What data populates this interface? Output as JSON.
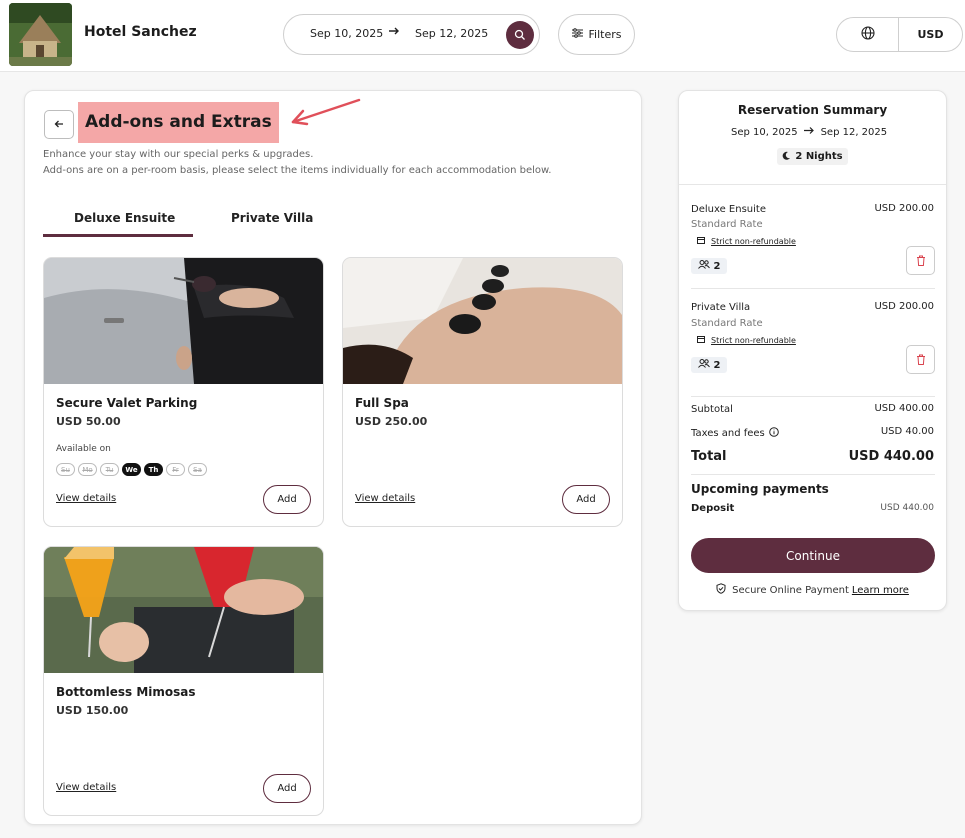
{
  "header": {
    "hotel_name": "Hotel Sanchez",
    "check_in": "Sep 10, 2025",
    "check_out": "Sep 12, 2025",
    "filters_label": "Filters",
    "currency": "USD",
    "icons": [
      "logo-photo",
      "arrow-right-icon",
      "search-icon",
      "sliders-icon",
      "globe-icon"
    ]
  },
  "main": {
    "title": "Add-ons and Extras",
    "description_line1": "Enhance your stay with our special perks & upgrades.",
    "description_line2": "Add-ons are on a per-room basis, please select the items individually for each accommodation below.",
    "tabs": [
      {
        "label": "Deluxe Ensuite",
        "active": true
      },
      {
        "label": "Private Villa",
        "active": false
      }
    ],
    "addons": [
      {
        "name": "Secure Valet Parking",
        "price": "USD 50.00",
        "available_label": "Available on",
        "days": [
          {
            "label": "Su",
            "available": false
          },
          {
            "label": "Mo",
            "available": false
          },
          {
            "label": "Tu",
            "available": false
          },
          {
            "label": "We",
            "available": true
          },
          {
            "label": "Th",
            "available": true
          },
          {
            "label": "Fr",
            "available": false
          },
          {
            "label": "Sa",
            "available": false
          }
        ],
        "details_label": "View details",
        "add_label": "Add"
      },
      {
        "name": "Full Spa",
        "price": "USD 250.00",
        "details_label": "View details",
        "add_label": "Add"
      },
      {
        "name": "Bottomless Mimosas",
        "price": "USD 150.00",
        "details_label": "View details",
        "add_label": "Add"
      }
    ]
  },
  "summary": {
    "title": "Reservation Summary",
    "check_in": "Sep 10, 2025",
    "check_out": "Sep 12, 2025",
    "nights": "2 Nights",
    "rooms": [
      {
        "name": "Deluxe Ensuite",
        "price": "USD 200.00",
        "rate": "Standard Rate",
        "policy": "Strict non-refundable",
        "guests": "2"
      },
      {
        "name": "Private Villa",
        "price": "USD 200.00",
        "rate": "Standard Rate",
        "policy": "Strict non-refundable",
        "guests": "2"
      }
    ],
    "subtotal_label": "Subtotal",
    "subtotal_value": "USD 400.00",
    "taxes_label": "Taxes and fees",
    "taxes_value": "USD 40.00",
    "total_label": "Total",
    "total_value": "USD 440.00",
    "upcoming_label": "Upcoming payments",
    "deposit_label": "Deposit",
    "deposit_value": "USD 440.00",
    "continue_label": "Continue",
    "secure_label": "Secure Online Payment",
    "learn_more_label": "Learn more"
  },
  "colors": {
    "brand": "#5e2d3f",
    "title_highlight": "#f4a7a7",
    "annotation_arrow": "#e0505a"
  }
}
